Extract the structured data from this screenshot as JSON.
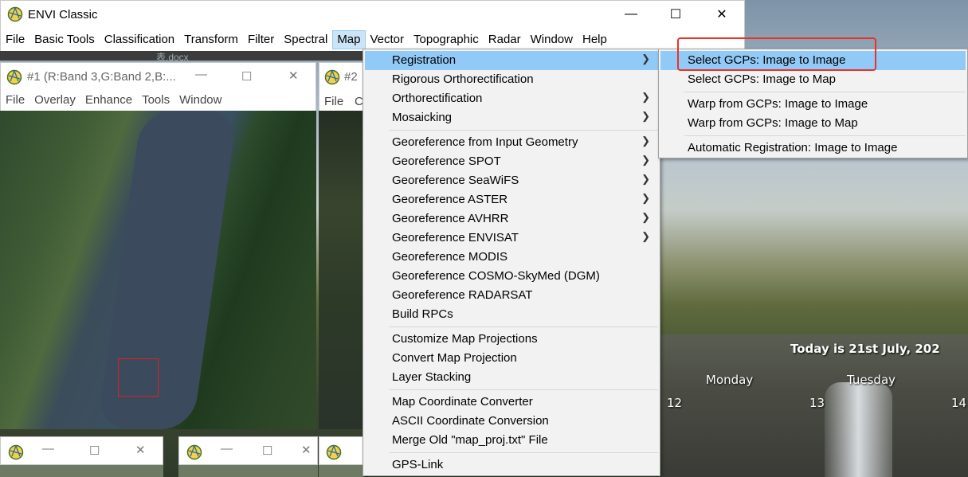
{
  "app": {
    "title": "ENVI Classic",
    "window_controls": {
      "minimize": "—",
      "maximize": "☐",
      "close": "✕"
    }
  },
  "menubar": [
    "File",
    "Basic Tools",
    "Classification",
    "Transform",
    "Filter",
    "Spectral",
    "Map",
    "Vector",
    "Topographic",
    "Radar",
    "Window",
    "Help"
  ],
  "active_menu": "Map",
  "background_tab_text": "表.docx",
  "image_window_1": {
    "title": "#1 (R:Band 3,G:Band 2,B:...",
    "menu": [
      "File",
      "Overlay",
      "Enhance",
      "Tools",
      "Window"
    ]
  },
  "image_window_2": {
    "title": "#2",
    "menu": [
      "File",
      "C"
    ]
  },
  "map_menu": {
    "items": [
      {
        "label": "Registration",
        "submenu": true,
        "highlighted": true
      },
      {
        "label": "Rigorous Orthorectification",
        "submenu": false
      },
      {
        "label": "Orthorectification",
        "submenu": true
      },
      {
        "label": "Mosaicking",
        "submenu": true
      },
      {
        "label": "Georeference from Input Geometry",
        "submenu": true
      },
      {
        "label": "Georeference SPOT",
        "submenu": true
      },
      {
        "label": "Georeference SeaWiFS",
        "submenu": true
      },
      {
        "label": "Georeference ASTER",
        "submenu": true
      },
      {
        "label": "Georeference AVHRR",
        "submenu": true
      },
      {
        "label": "Georeference ENVISAT",
        "submenu": true
      },
      {
        "label": "Georeference MODIS",
        "submenu": false
      },
      {
        "label": "Georeference COSMO-SkyMed (DGM)",
        "submenu": false
      },
      {
        "label": "Georeference RADARSAT",
        "submenu": false
      },
      {
        "label": "Build RPCs",
        "submenu": false
      },
      {
        "label": "Customize Map Projections",
        "submenu": false
      },
      {
        "label": "Convert Map Projection",
        "submenu": false
      },
      {
        "label": "Layer Stacking",
        "submenu": false
      },
      {
        "label": "Map Coordinate Converter",
        "submenu": false
      },
      {
        "label": "ASCII Coordinate Conversion",
        "submenu": false
      },
      {
        "label": "Merge Old \"map_proj.txt\" File",
        "submenu": false
      },
      {
        "label": "GPS-Link",
        "submenu": false
      }
    ]
  },
  "registration_submenu": {
    "items": [
      {
        "label": "Select GCPs: Image to Image",
        "highlighted": true
      },
      {
        "label": "Select GCPs: Image to Map"
      },
      {
        "label": "Warp from GCPs: Image to Image"
      },
      {
        "label": "Warp from GCPs: Image to Map"
      },
      {
        "label": "Automatic Registration: Image to Image"
      }
    ]
  },
  "calendar_widget": {
    "today": "Today is 21st July, 202",
    "days": [
      "Monday",
      "Tuesday"
    ],
    "dates": [
      "12",
      "13",
      "14"
    ]
  },
  "colors": {
    "menu_highlight": "#91c9f7",
    "annotation_frame": "#e8332a",
    "active_menubar": "#cce4f7"
  }
}
